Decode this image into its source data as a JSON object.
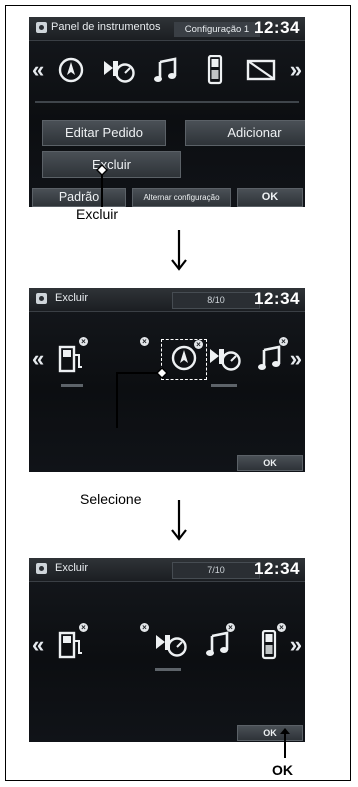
{
  "step1": {
    "title": "Panel de instrumentos",
    "config": "Configuração 1",
    "clock": "12:34",
    "left_chevron": "«",
    "right_chevron": "»",
    "buttons": {
      "edit": "Editar Pedido",
      "add": "Adicionar",
      "delete": "Excluir",
      "default": "Padrão",
      "switch": "Alternar configuração",
      "ok": "OK"
    },
    "icons": [
      "compass-icon",
      "speedometer-icon",
      "music-icon",
      "phone-icon",
      "no-display-icon"
    ]
  },
  "step2": {
    "title": "Excluir",
    "counter": "8/10",
    "clock": "12:34",
    "left_chevron": "«",
    "right_chevron": "»",
    "delete_mark": "×",
    "ok": "OK",
    "icons": [
      "fuel-icon",
      "compass-icon",
      "speedometer-icon",
      "music-icon"
    ]
  },
  "step3": {
    "title": "Excluir",
    "counter": "7/10",
    "clock": "12:34",
    "left_chevron": "«",
    "right_chevron": "»",
    "delete_mark": "×",
    "ok": "OK",
    "icons": [
      "fuel-icon",
      "speedometer-icon",
      "music-icon",
      "phone-icon"
    ]
  },
  "captions": {
    "excluir": "Excluir",
    "selecione": "Selecione",
    "ok": "OK"
  }
}
